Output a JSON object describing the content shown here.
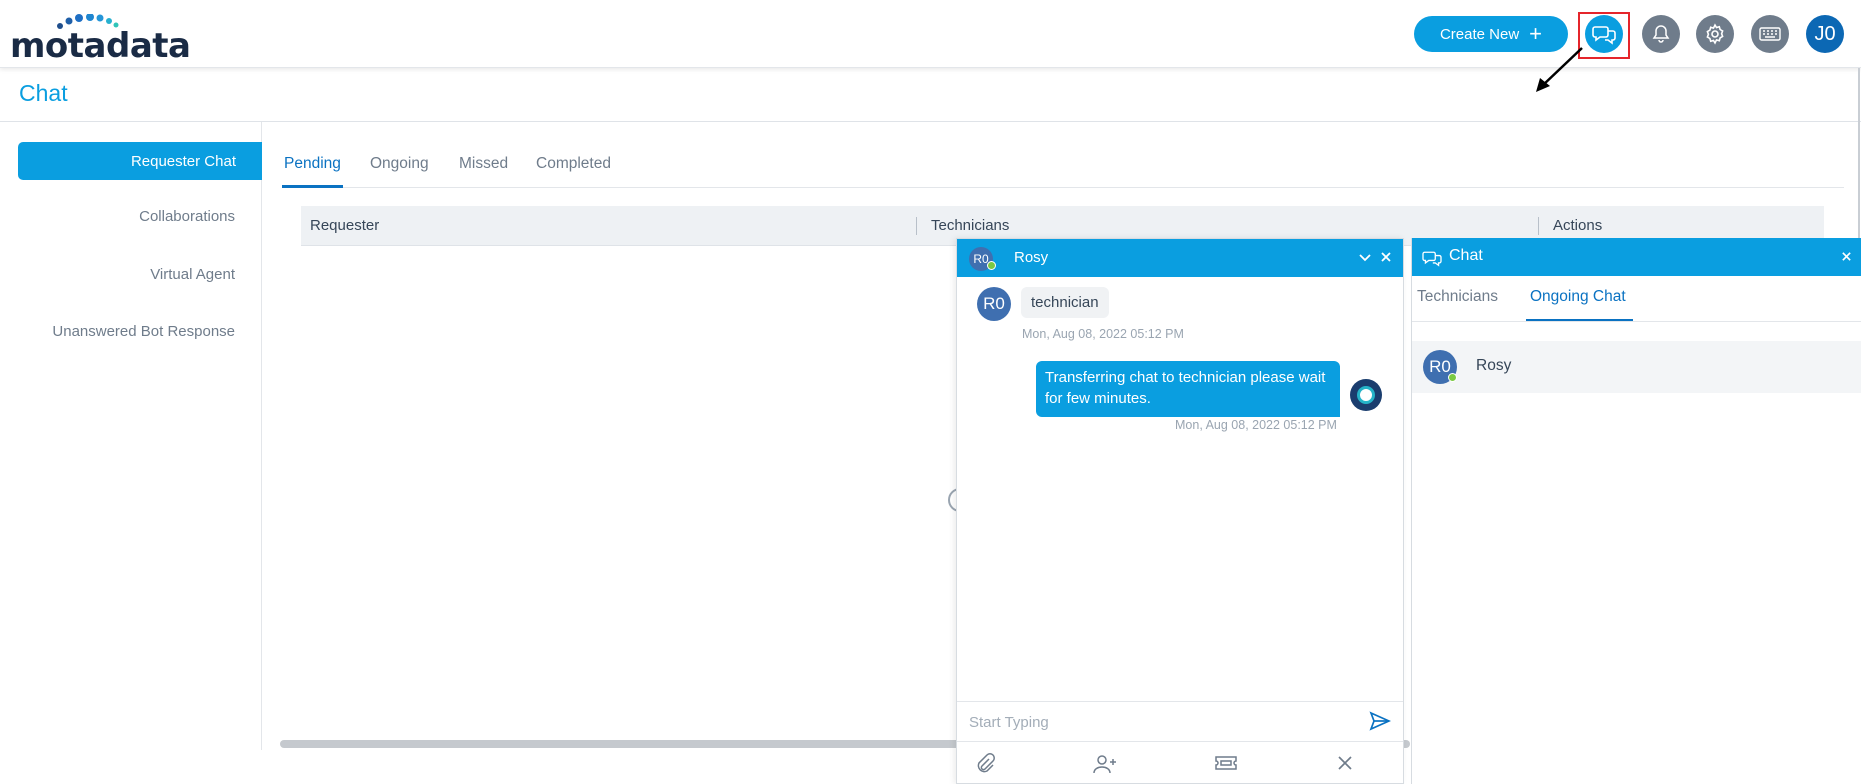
{
  "app": {
    "logo_text": "motadata"
  },
  "header": {
    "create_new_label": "Create New",
    "create_new_icon": "plus-icon",
    "icons": [
      "chat-icon",
      "bell-icon",
      "gear-icon",
      "keyboard-icon"
    ],
    "user_initials": "J0"
  },
  "page": {
    "title": "Chat"
  },
  "sidebar": {
    "items": [
      {
        "label": "Requester Chat",
        "active": true
      },
      {
        "label": "Collaborations",
        "active": false
      },
      {
        "label": "Virtual Agent",
        "active": false
      },
      {
        "label": "Unanswered Bot Response",
        "active": false
      }
    ]
  },
  "tabs": [
    {
      "label": "Pending",
      "active": true
    },
    {
      "label": "Ongoing",
      "active": false
    },
    {
      "label": "Missed",
      "active": false
    },
    {
      "label": "Completed",
      "active": false
    }
  ],
  "table": {
    "columns": [
      "Requester",
      "Technicians",
      "Actions"
    ]
  },
  "chat_window": {
    "avatar": "R0",
    "name": "Rosy",
    "messages": [
      {
        "direction": "in",
        "avatar": "R0",
        "text": "technician",
        "time": "Mon, Aug 08, 2022 05:12 PM"
      },
      {
        "direction": "out",
        "text": "Transferring chat to technician please wait for few minutes.",
        "time": "Mon, Aug 08, 2022 05:12 PM"
      }
    ],
    "input_placeholder": "Start Typing",
    "tool_icons": [
      "attachment-icon",
      "add-user-icon",
      "ticket-icon",
      "close-icon"
    ]
  },
  "chat_panel": {
    "title": "Chat",
    "tabs": [
      {
        "label": "Technicians",
        "active": false
      },
      {
        "label": "Ongoing Chat",
        "active": true
      }
    ],
    "conversations": [
      {
        "avatar": "R0",
        "name": "Rosy",
        "online": true
      }
    ]
  },
  "colors": {
    "accent": "#0a9ee0",
    "primary_dark": "#0a72c2",
    "highlight": "#e5252b",
    "online": "#7ac943"
  }
}
